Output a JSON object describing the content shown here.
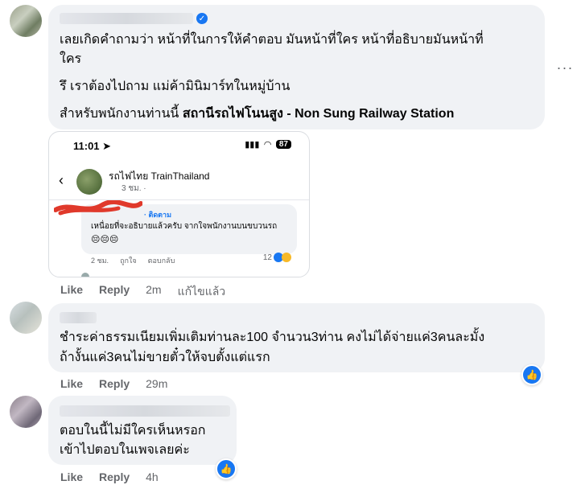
{
  "comments": [
    {
      "lines": [
        "เลยเกิดคำถามว่า หน้าที่ในการให้คำตอบ มันหน้าที่ใคร หน้าที่อธิบายมันหน้าที่",
        "ใคร",
        "รึ เราต้องไปถาม แม่ค้ามินิมาร์ทในหมู่บ้าน"
      ],
      "last_line_plain": "สำหรับพนักงานท่านนี้ ",
      "last_line_bold": "สถานีรถไฟโนนสูง - Non Sung Railway Station",
      "like_label": "Like",
      "reply_label": "Reply",
      "time": "2m",
      "edited_label": "แก้ไขแล้ว",
      "more_dots": "···"
    },
    {
      "lines": [
        "ชำระค่าธรรมเนียมเพิ่มเติมท่านละ100 จำนวน3ท่าน คงไม่ได้จ่ายแค่3คนละมั้ง",
        "ถ้างั้นแค่3คนไม่ขายตั๋วให้จบตั้งแต่แรก"
      ],
      "like_label": "Like",
      "reply_label": "Reply",
      "time": "29m"
    },
    {
      "lines": [
        "ตอบในนี้ไม่มีใครเห็นหรอก",
        "เข้าไปตอบในเพจเลยค่ะ"
      ],
      "like_label": "Like",
      "reply_label": "Reply",
      "time": "4h"
    }
  ],
  "embedded_screenshot": {
    "clock": "11:01",
    "battery": "87",
    "page_name": "รถไฟไทย TrainThailand",
    "page_time": "3 ชม. ·",
    "follow_label": "· ติดตาม",
    "comment_text": "เหนื่อยที่จะอธิบายแล้วครับ จากใจพนักงานบนขบวนรถ",
    "emojis": "😔😔😔",
    "time": "2 ชม.",
    "like": "ถูกใจ",
    "reply": "ตอบกลับ",
    "reaction_count": "12"
  },
  "colors": {
    "accent": "#1877f2",
    "bubble": "#f0f2f5",
    "muted": "#65676b",
    "scribble": "#e0392b"
  }
}
